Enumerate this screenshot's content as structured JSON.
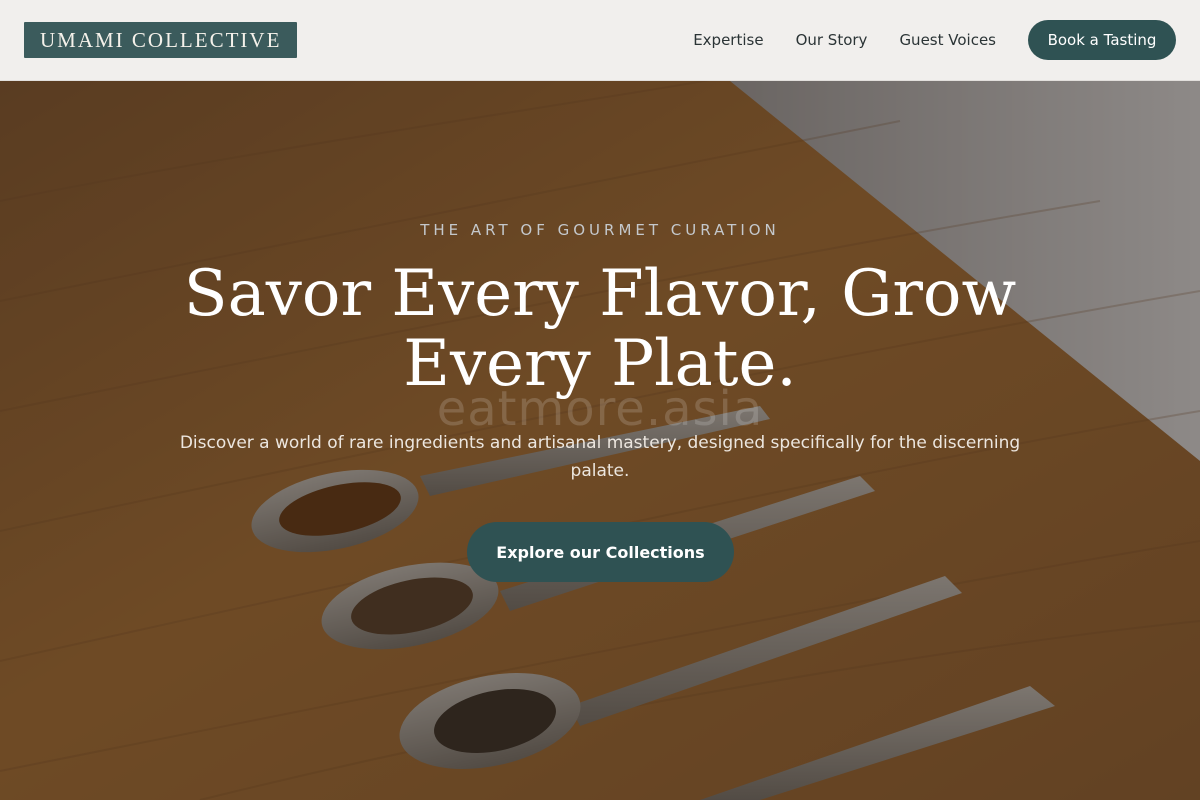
{
  "header": {
    "logo": "UMAMI COLLECTIVE",
    "nav": [
      {
        "label": "Expertise"
      },
      {
        "label": "Our Story"
      },
      {
        "label": "Guest Voices"
      }
    ],
    "cta_label": "Book a Tasting"
  },
  "hero": {
    "eyebrow": "THE ART OF GOURMET CURATION",
    "headline": "Savor Every Flavor, Grow Every Plate.",
    "watermark": "eatmore.asia",
    "subtext": "Discover a world of rare ingredients and artisanal mastery, designed specifically for the discerning palate.",
    "cta_label": "Explore our Collections"
  },
  "colors": {
    "brand": "#3b5b5c",
    "button": "#2f5253",
    "header_bg": "#f1efed"
  }
}
